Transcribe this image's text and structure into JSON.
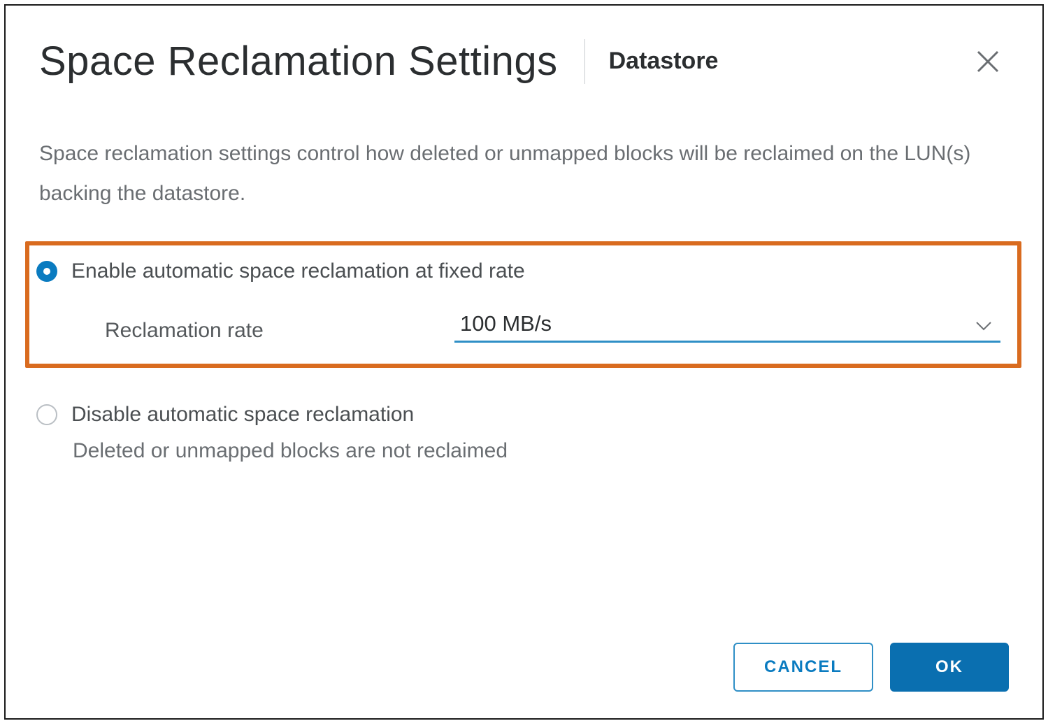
{
  "header": {
    "title": "Space Reclamation Settings",
    "subtitle": "Datastore"
  },
  "description": "Space reclamation settings control how deleted or unmapped blocks will be reclaimed on the LUN(s) backing the datastore.",
  "option_enable": {
    "label": "Enable automatic space reclamation at fixed rate",
    "rate_label": "Reclamation rate",
    "rate_value": "100 MB/s"
  },
  "option_disable": {
    "label": "Disable automatic space reclamation",
    "subtext": "Deleted or unmapped blocks are not reclaimed"
  },
  "buttons": {
    "cancel": "CANCEL",
    "ok": "OK"
  }
}
